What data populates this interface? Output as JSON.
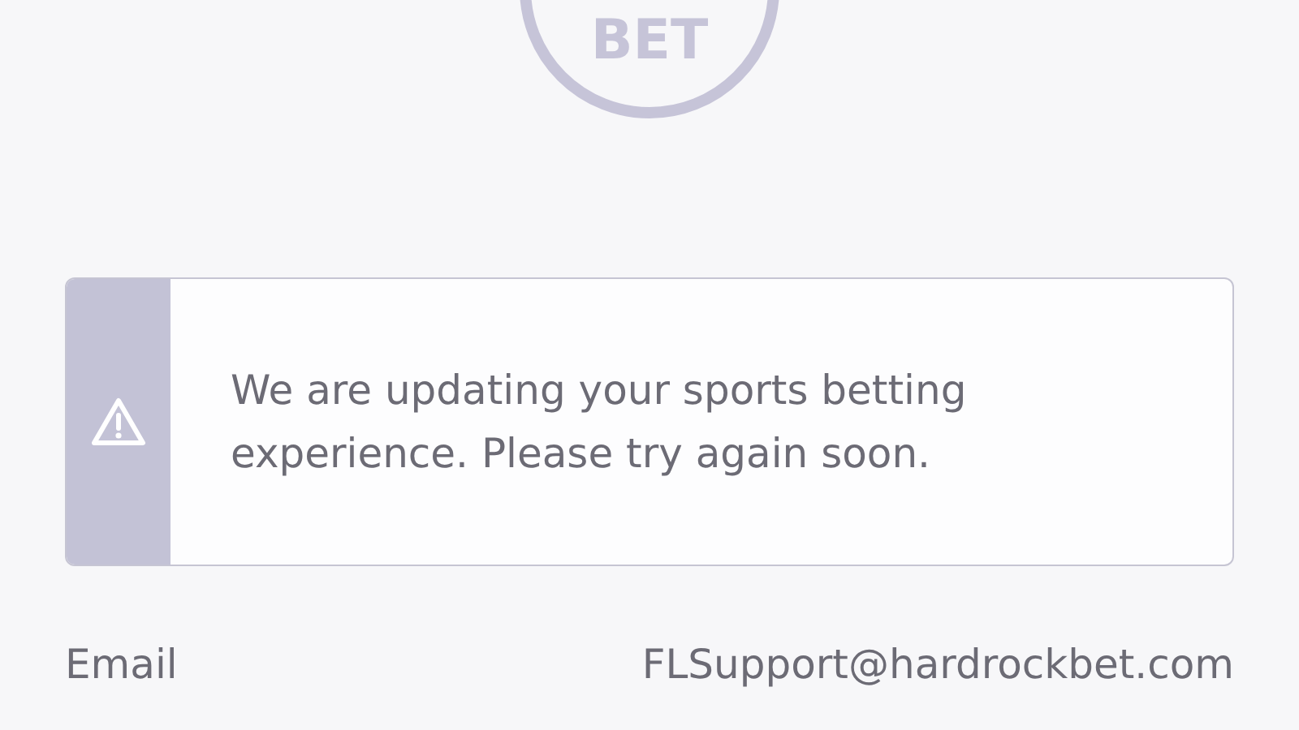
{
  "logo": {
    "text": "BET"
  },
  "alert": {
    "kind": "warning",
    "message": "We are updating your sports betting experience. Please try again soon."
  },
  "contact": {
    "label": "Email",
    "value": "FLSupport@hardrockbet.com"
  }
}
